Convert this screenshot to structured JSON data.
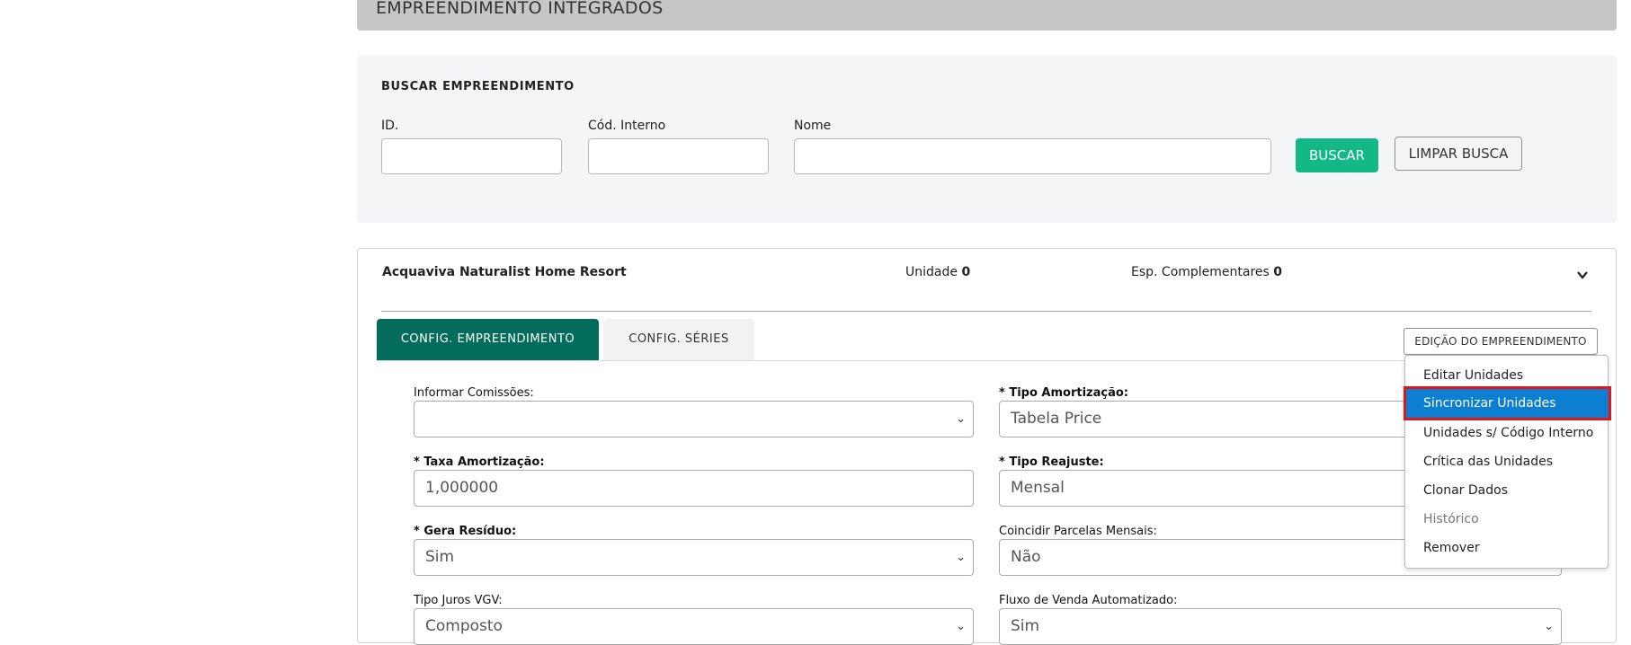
{
  "page_title": "EMPREENDIMENTO INTEGRADOS",
  "search": {
    "title": "BUSCAR EMPREENDIMENTO",
    "id_label": "ID.",
    "id_value": "",
    "cod_label": "Cód. Interno",
    "cod_value": "",
    "nome_label": "Nome",
    "nome_value": "",
    "buscar_button": "BUSCAR",
    "limpar_button": "LIMPAR BUSCA"
  },
  "card": {
    "name": "Acquaviva Naturalist Home Resort",
    "unidade_label": "Unidade",
    "unidade_value": "0",
    "esp_label": "Esp. Complementares",
    "esp_value": "0",
    "tabs": [
      {
        "label": "CONFIG. EMPREENDIMENTO",
        "active": true
      },
      {
        "label": "CONFIG. SÉRIES",
        "active": false
      }
    ],
    "edit_button": "EDIÇÃO DO EMPREENDIMENTO"
  },
  "form": {
    "informar_comissoes": {
      "label": "Informar Comissões:",
      "value": ""
    },
    "tipo_amortizacao": {
      "label": "* Tipo Amortização:",
      "value": "Tabela Price"
    },
    "taxa_amortizacao": {
      "label": "* Taxa Amortização:",
      "value": "1,000000"
    },
    "tipo_reajuste": {
      "label": "* Tipo Reajuste:",
      "value": "Mensal"
    },
    "gera_residuo": {
      "label": "* Gera Resíduo:",
      "value": "Sim"
    },
    "coincidir_parcelas": {
      "label": "Coincidir Parcelas Mensais:",
      "value": "Não"
    },
    "tipo_juros": {
      "label": "Tipo Juros VGV:",
      "value": "Composto"
    },
    "fluxo_venda": {
      "label": "Fluxo de Venda Automatizado:",
      "value": "Sim"
    }
  },
  "dropdown_menu": {
    "items": [
      {
        "label": "Editar Unidades",
        "state": "normal"
      },
      {
        "label": "Sincronizar Unidades",
        "state": "highlighted"
      },
      {
        "label": "Unidades s/ Código Interno",
        "state": "normal"
      },
      {
        "label": "Crítica das Unidades",
        "state": "normal"
      },
      {
        "label": "Clonar Dados",
        "state": "normal"
      },
      {
        "label": "Histórico",
        "state": "disabled"
      },
      {
        "label": "Remover",
        "state": "normal"
      }
    ],
    "highlight_color": "#0d7fd3",
    "focus_outline_color": "#e0161b"
  },
  "colors": {
    "primary_green": "#12b886",
    "active_tab": "#036c5a",
    "banner_gray": "#c6c6c6"
  }
}
